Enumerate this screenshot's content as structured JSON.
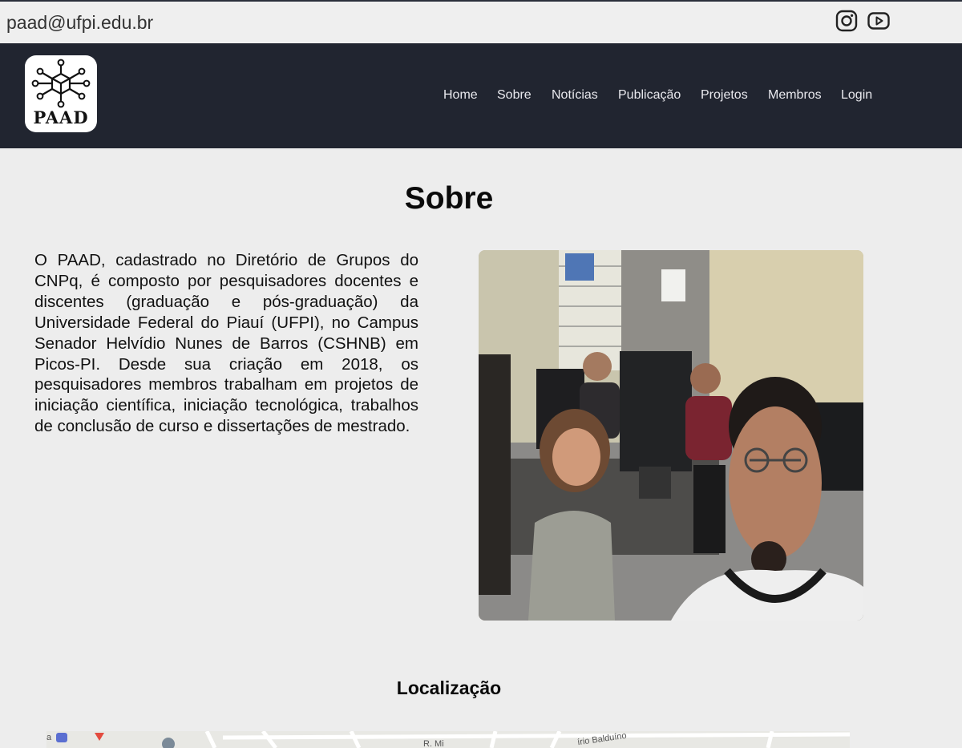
{
  "topbar": {
    "email": "paad@ufpi.edu.br",
    "icons": [
      "instagram-icon",
      "youtube-icon"
    ]
  },
  "navbar": {
    "logo_text": "PAAD",
    "items": [
      "Home",
      "Sobre",
      "Notícias",
      "Publicação",
      "Projetos",
      "Membros",
      "Login"
    ]
  },
  "main": {
    "title": "Sobre",
    "text": "O PAAD, cadastrado no Diretório de Grupos do CNPq, é composto por pesquisadores docentes e discentes (graduação e pós-graduação) da Universidade Federal do Piauí (UFPI), no Campus Senador Helvídio Nunes de Barros (CSHNB) em Picos-PI. Desde sua criação em 2018, os pesquisadores membros trabalham em projetos de iniciação científica, iniciação tecnológica, trabalhos de conclusão de curso e dissertações de mestrado."
  },
  "location": {
    "title": "Localização",
    "map_labels": [
      "a",
      "R. Mi",
      "írio Balduíno"
    ]
  },
  "colors": {
    "navbar_bg": "#212530",
    "page_bg": "#ededed",
    "topbar_bg": "#efefef"
  }
}
